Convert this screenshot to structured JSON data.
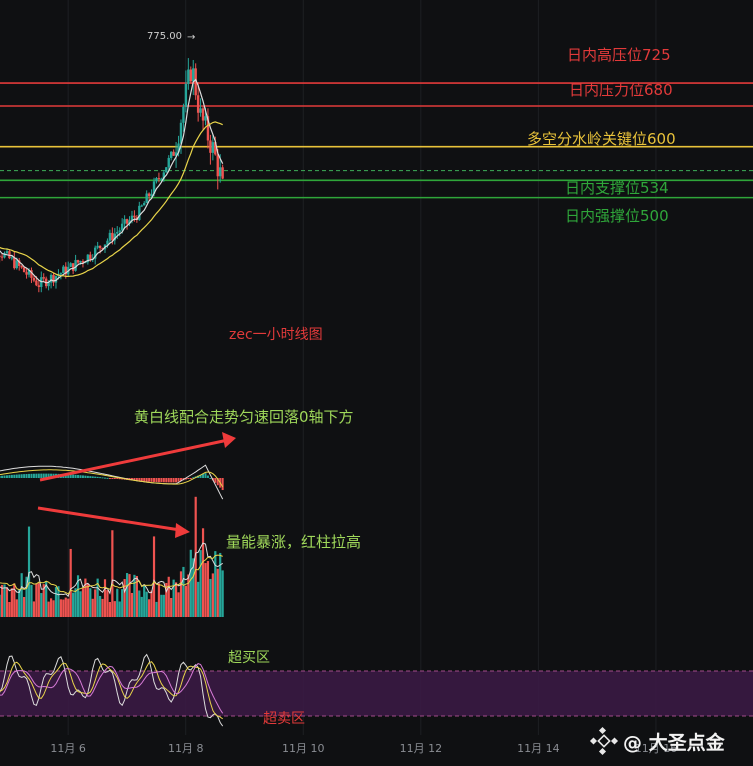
{
  "chart_data": {
    "type": "candlestick",
    "subtitle": "zec一小时线图",
    "peak_label": "775.00",
    "x_ticks": [
      "11月 6",
      "11月 8",
      "11月 10",
      "11月 12",
      "11月 14",
      "11月 16"
    ],
    "x_tick_values": [
      6,
      8,
      10,
      12,
      14,
      16
    ],
    "x_range": [
      4.5,
      17.6
    ],
    "y_range": [
      240,
      790
    ],
    "levels": [
      {
        "label": "日内高压位725",
        "value": 725,
        "color": "#e23a3a"
      },
      {
        "label": "日内压力位680",
        "value": 680,
        "color": "#e23a3a"
      },
      {
        "label": "多空分水岭关键位600",
        "value": 600,
        "color": "#e8c23a"
      },
      {
        "label": "日内支撑位534",
        "value": 534,
        "color": "#2fa63a"
      },
      {
        "label": "日内强撑位500",
        "value": 500,
        "color": "#2fa63a"
      }
    ],
    "current_price": 553,
    "price_x": [
      4.5,
      5.0,
      5.5,
      6.0,
      6.4,
      6.8,
      7.2,
      7.5,
      7.8,
      8.0,
      8.1,
      8.25,
      8.45,
      8.65
    ],
    "price_close": [
      420,
      380,
      330,
      360,
      390,
      430,
      470,
      530,
      590,
      700,
      760,
      660,
      600,
      520
    ],
    "indicator_panels": [
      {
        "name": "macd",
        "annotation": "黄白线配合走势匀速回落0轴下方"
      },
      {
        "name": "volume",
        "annotation": "量能暴涨，红柱拉高"
      },
      {
        "name": "kdj",
        "overbought_label": "超买区",
        "oversold_label": "超卖区"
      }
    ],
    "watermark": "@ 大圣点金",
    "colors": {
      "up": "#26a69a",
      "down": "#ef5350",
      "ma_yellow": "#e8d44a",
      "ma_white": "#dddddd",
      "ma_pink": "#d67ad6",
      "zone": "#3a1a44"
    }
  }
}
